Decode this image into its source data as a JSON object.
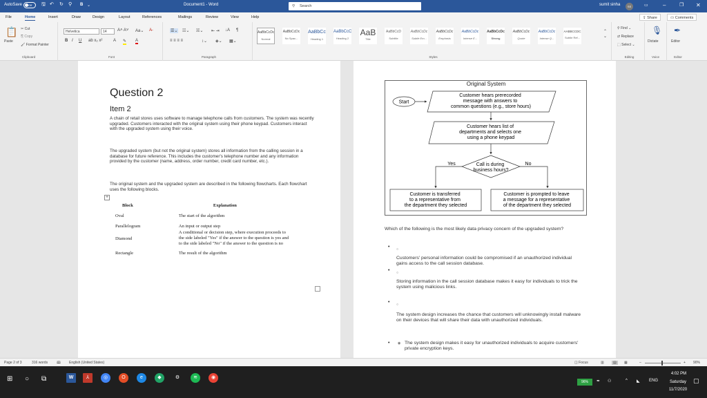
{
  "window": {
    "autosave_label": "AutoSave",
    "autosave_state": "Off",
    "doc_title": "Document1 - Word",
    "search_label": "Search",
    "user_name": "sumit sinha",
    "user_initials": "SS",
    "quick_bold": "B"
  },
  "tabs": [
    "File",
    "Home",
    "Insert",
    "Draw",
    "Design",
    "Layout",
    "References",
    "Mailings",
    "Review",
    "View",
    "Help"
  ],
  "share_label": "Share",
  "comments_label": "Comments",
  "ribbon": {
    "clipboard": {
      "paste": "Paste",
      "cut": "Cut",
      "copy": "Copy",
      "format_painter": "Format Painter",
      "label": "Clipboard"
    },
    "font": {
      "name": "Helvetica",
      "size": "14",
      "label": "Font",
      "bold": "B",
      "italic": "I",
      "underline": "U"
    },
    "paragraph": {
      "label": "Paragraph"
    },
    "styles": {
      "label": "Styles",
      "items": [
        {
          "preview": "AaBbCcDc",
          "name": "Normal"
        },
        {
          "preview": "AaBbCcDc",
          "name": "No Spac..."
        },
        {
          "preview": "AaBbCc",
          "name": "Heading 1"
        },
        {
          "preview": "AaBbCcC",
          "name": "Heading 2"
        },
        {
          "preview": "AaB",
          "name": "Title"
        },
        {
          "preview": "AaBbCcD",
          "name": "Subtitle"
        },
        {
          "preview": "AaBbCcDc",
          "name": "Subtle Em..."
        },
        {
          "preview": "AaBbCcDc",
          "name": "Emphasis"
        },
        {
          "preview": "AaBbCcDc",
          "name": "Intense E..."
        },
        {
          "preview": "AaBbCcDc",
          "name": "Strong"
        },
        {
          "preview": "AaBbCcDc",
          "name": "Quote"
        },
        {
          "preview": "AaBbCcDc",
          "name": "Intense Q..."
        },
        {
          "preview": "AABBCCDC",
          "name": "Subtle Ref..."
        }
      ]
    },
    "editing": {
      "find": "Find",
      "replace": "Replace",
      "select": "Select",
      "label": "Editing"
    },
    "voice": {
      "dictate": "Dictate",
      "label": "Voice"
    },
    "editor": {
      "editor": "Editor",
      "label": "Editor"
    }
  },
  "doc": {
    "title": "Question 2",
    "item": "Item 2",
    "p1": "A chain of retail stores uses software to manage telephone calls from customers. The system was recently upgraded. Customers interacted with the original system using their phone keypad. Customers interact with the upgraded system using their voice.",
    "p2": "The upgraded system (but not the original system) stores all information from the calling session in a database for future reference. This includes the customer's telephone number and any information provided by the customer (name, address, order number, credit card number, etc.).",
    "p3": "The original system and the upgraded system are described in the following flowcharts. Each flowchart uses the following blocks.",
    "table_headers": [
      "Block",
      "Explanation"
    ],
    "table_rows": [
      [
        "Oval",
        "The start of the algorithm"
      ],
      [
        "Parallelogram",
        "An input or output step"
      ],
      [
        "Diamond",
        "A conditional or decision step, where execution proceeds to the side labeled \"Yes\" if the answer to the question is yes and to the side labeled \"No\" if the answer to the question is no"
      ],
      [
        "Rectangle",
        "The result of the algorithm"
      ]
    ]
  },
  "flowchart": {
    "title": "Original System",
    "start": "Start",
    "input1": [
      "Customer hears prerecorded",
      "message with answers to",
      "common questions (e.g., store hours)"
    ],
    "input2": [
      "Customer hears list of",
      "departments and selects one",
      "using a phone keypad"
    ],
    "decision": [
      "Call is during",
      "business hours?"
    ],
    "yes": "Yes",
    "no": "No",
    "result_yes": [
      "Customer is transferred",
      "to a representative from",
      "the department they selected"
    ],
    "result_no": [
      "Customer is prompted to leave",
      "a message for a representative",
      "of the department they selected"
    ]
  },
  "question": {
    "text": "Which of the following is the most likely data privacy concern of the upgraded system?",
    "options": [
      "Customers' personal information could be compromised if an unauthorized individual gains access to the call session database.",
      "Storing information in the call session database makes it easy for individuals to trick the system using malicious links.",
      "The system design increases the chance that customers will unknowingly install malware on their devices that will share their data with unauthorized individuals.",
      "The system design makes it easy for unauthorized individuals to acquire customers' private encryption keys."
    ]
  },
  "status": {
    "page": "Page 2 of 3",
    "words": "316 words",
    "language": "English (United States)",
    "focus": "Focus",
    "zoom": "90%"
  },
  "taskbar": {
    "battery": "96%",
    "lang": "ENG",
    "time": "4:02 PM",
    "day": "Saturday",
    "date": "11/7/2020"
  }
}
